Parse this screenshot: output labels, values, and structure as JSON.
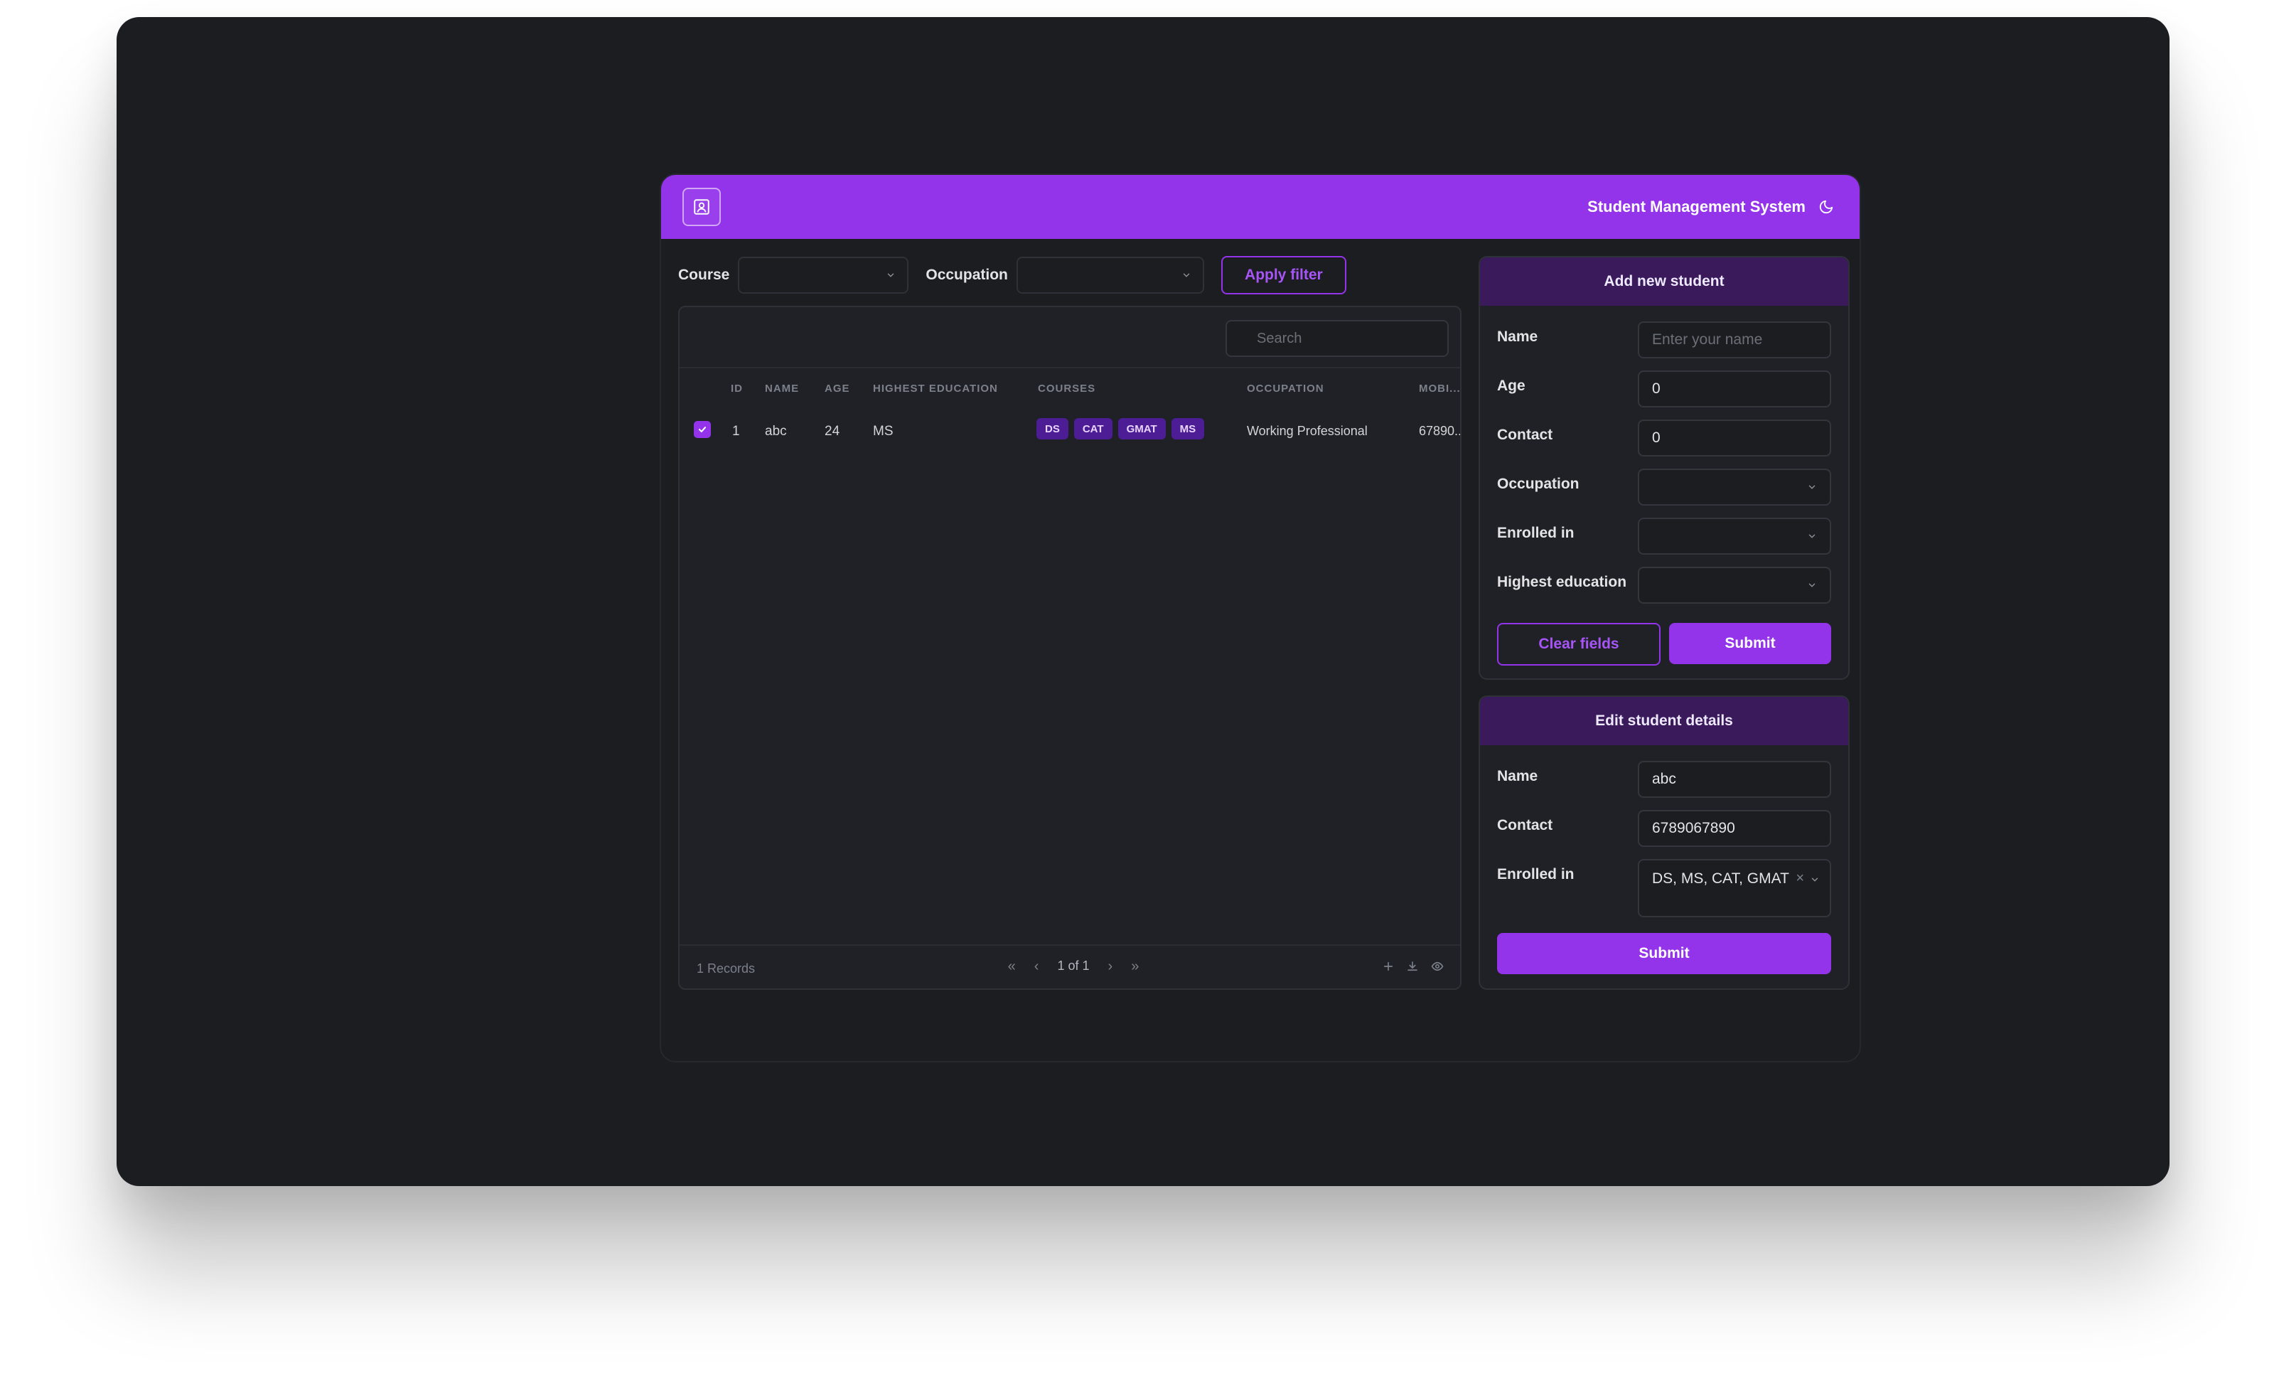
{
  "header": {
    "title": "Student Management System",
    "logo_icon": "contact-card-icon",
    "theme_icon": "moon-icon"
  },
  "filters": {
    "course_label": "Course",
    "course_value": "",
    "occupation_label": "Occupation",
    "occupation_value": "",
    "apply_label": "Apply filter"
  },
  "table": {
    "search_placeholder": "Search",
    "columns": [
      "ID",
      "NAME",
      "AGE",
      "HIGHEST EDUCATION",
      "COURSES",
      "OCCUPATION",
      "MOBI..."
    ],
    "rows": [
      {
        "selected": true,
        "id": "1",
        "name": "abc",
        "age": "24",
        "education": "MS",
        "courses": [
          "DS",
          "CAT",
          "GMAT",
          "MS"
        ],
        "occupation": "Working Professional",
        "mobile": "67890..."
      }
    ],
    "records_text": "1 Records",
    "page_text": "1 of 1",
    "pager_first": "«",
    "pager_prev": "‹",
    "pager_next": "›",
    "pager_last": "»"
  },
  "add_form": {
    "title": "Add new student",
    "name_label": "Name",
    "name_placeholder": "Enter your name",
    "age_label": "Age",
    "age_value": "0",
    "contact_label": "Contact",
    "contact_value": "0",
    "occupation_label": "Occupation",
    "enrolled_label": "Enrolled in",
    "education_label": "Highest education",
    "clear_label": "Clear fields",
    "submit_label": "Submit"
  },
  "edit_form": {
    "title": "Edit student details",
    "name_label": "Name",
    "name_value": "abc",
    "contact_label": "Contact",
    "contact_value": "6789067890",
    "enrolled_label": "Enrolled in",
    "enrolled_value": "DS, MS, CAT, GMAT",
    "clear_glyph": "×",
    "submit_label": "Submit"
  },
  "colors": {
    "accent": "#9333ea",
    "panel_header": "#3b1a5c",
    "background": "#1b1d21",
    "badge": "#4c1d95"
  }
}
